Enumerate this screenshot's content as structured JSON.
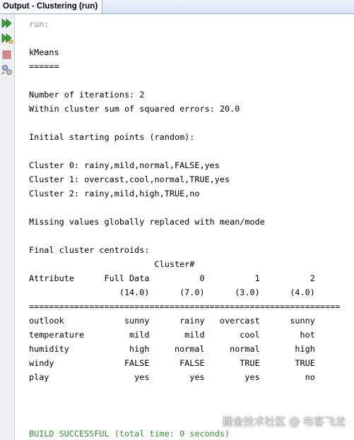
{
  "window": {
    "tab_title": "Output - Clustering (run)"
  },
  "toolbar": {
    "buttons": [
      {
        "icon": "rerun-icon"
      },
      {
        "icon": "rerun-with-options-icon"
      },
      {
        "icon": "stop-icon"
      },
      {
        "icon": "settings-icon"
      }
    ]
  },
  "output": {
    "lines": [
      "run:",
      "",
      "kMeans",
      "======",
      "",
      "Number of iterations: 2",
      "Within cluster sum of squared errors: 20.0",
      "",
      "Initial starting points (random):",
      "",
      "Cluster 0: rainy,mild,normal,FALSE,yes",
      "Cluster 1: overcast,cool,normal,TRUE,yes",
      "Cluster 2: rainy,mild,high,TRUE,no",
      "",
      "Missing values globally replaced with mean/mode",
      "",
      "Final cluster centroids:",
      "                         Cluster#",
      "Attribute      Full Data          0          1          2",
      "                  (14.0)      (7.0)      (3.0)      (4.0)",
      "==============================================================",
      "outlook            sunny      rainy   overcast      sunny",
      "temperature         mild       mild       cool        hot",
      "humidity            high     normal     normal       high",
      "windy              FALSE      FALSE       TRUE       TRUE",
      "play                 yes        yes        yes         no",
      "",
      "",
      "",
      "BUILD SUCCESSFUL (total time: 0 seconds)"
    ]
  },
  "watermark": "掘金技术社区 @ 布客飞龙",
  "colors": {
    "run_text": "#8a8a8a",
    "build_success": "#2f8f2f",
    "rerun_icon": "#35a235",
    "stop_icon": "#d08a8a"
  }
}
